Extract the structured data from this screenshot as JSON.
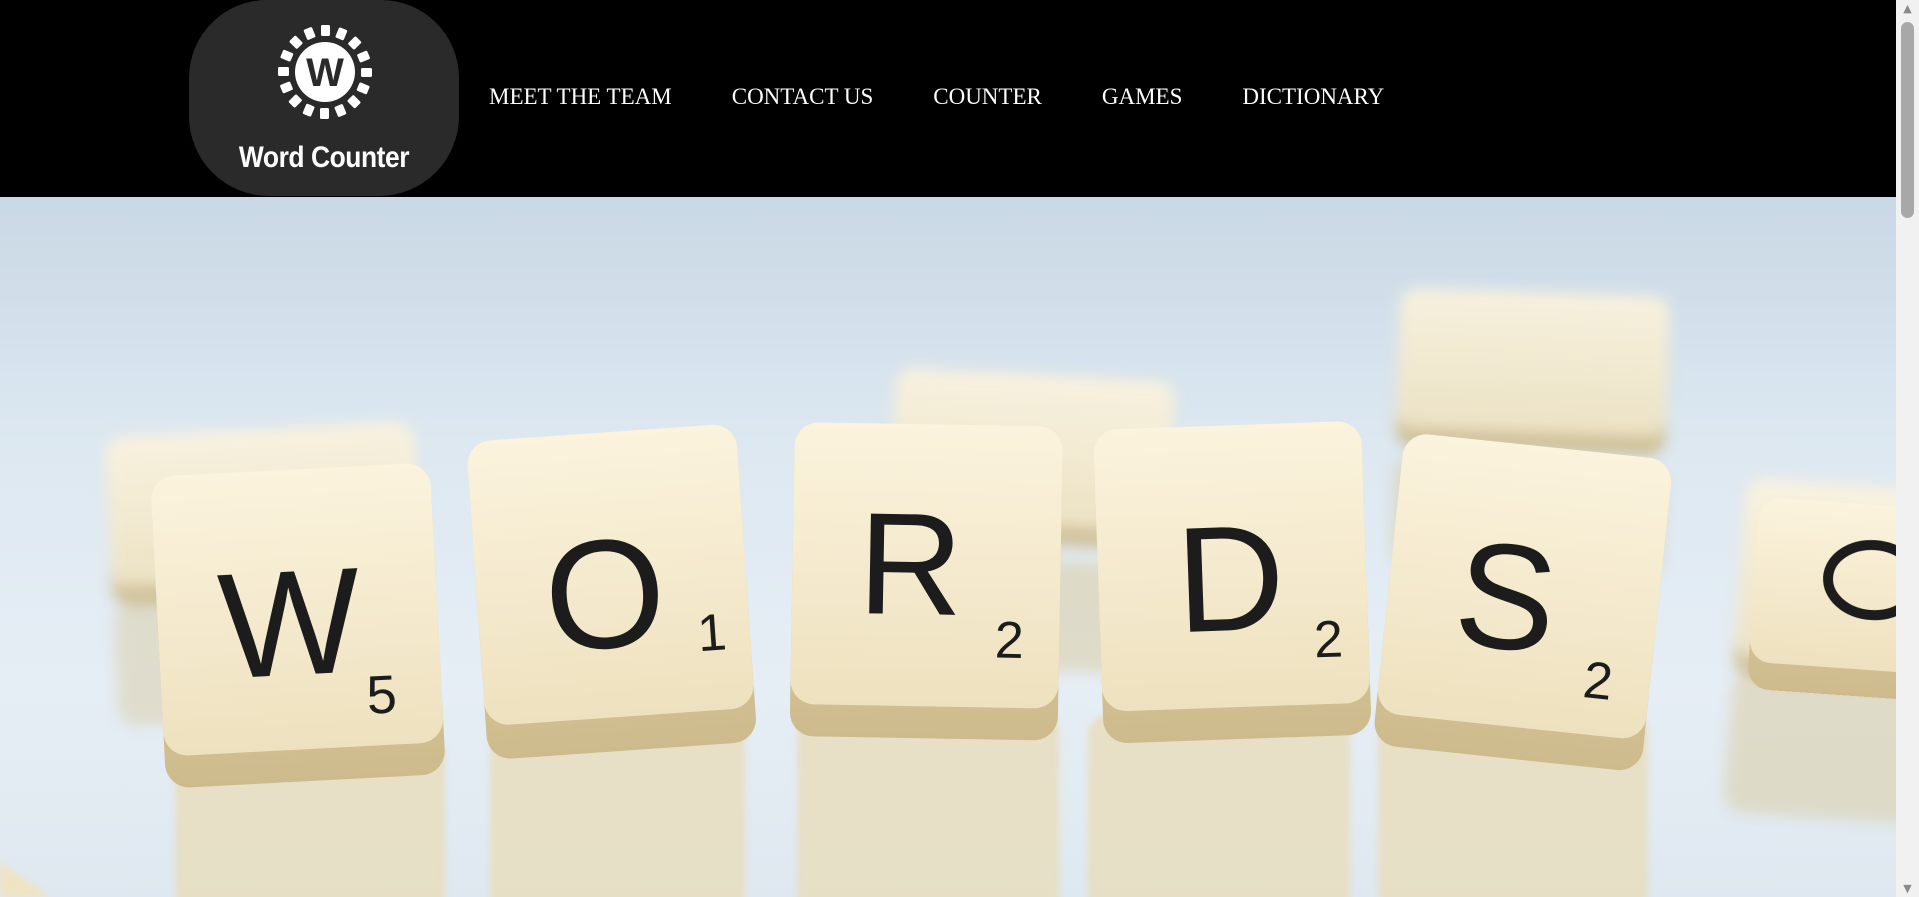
{
  "header": {
    "logo": {
      "letter": "W",
      "text": "Word Counter",
      "icon": "gear-w-logo-icon"
    },
    "nav": [
      {
        "label": "MEET THE TEAM"
      },
      {
        "label": "CONTACT US"
      },
      {
        "label": "COUNTER"
      },
      {
        "label": "GAMES"
      },
      {
        "label": "DICTIONARY"
      }
    ]
  },
  "hero": {
    "tiles": [
      {
        "letter": "W",
        "score": "5"
      },
      {
        "letter": "O",
        "score": "1"
      },
      {
        "letter": "R",
        "score": "2"
      },
      {
        "letter": "D",
        "score": "2"
      },
      {
        "letter": "S",
        "score": "2"
      }
    ]
  },
  "scrollbar": {
    "up_icon": "▲",
    "down_icon": "▼"
  },
  "colors": {
    "header_bg": "#000000",
    "logo_bg": "#2a2a2a",
    "nav_text": "#ffffff",
    "tile": "#f1e6c8"
  }
}
